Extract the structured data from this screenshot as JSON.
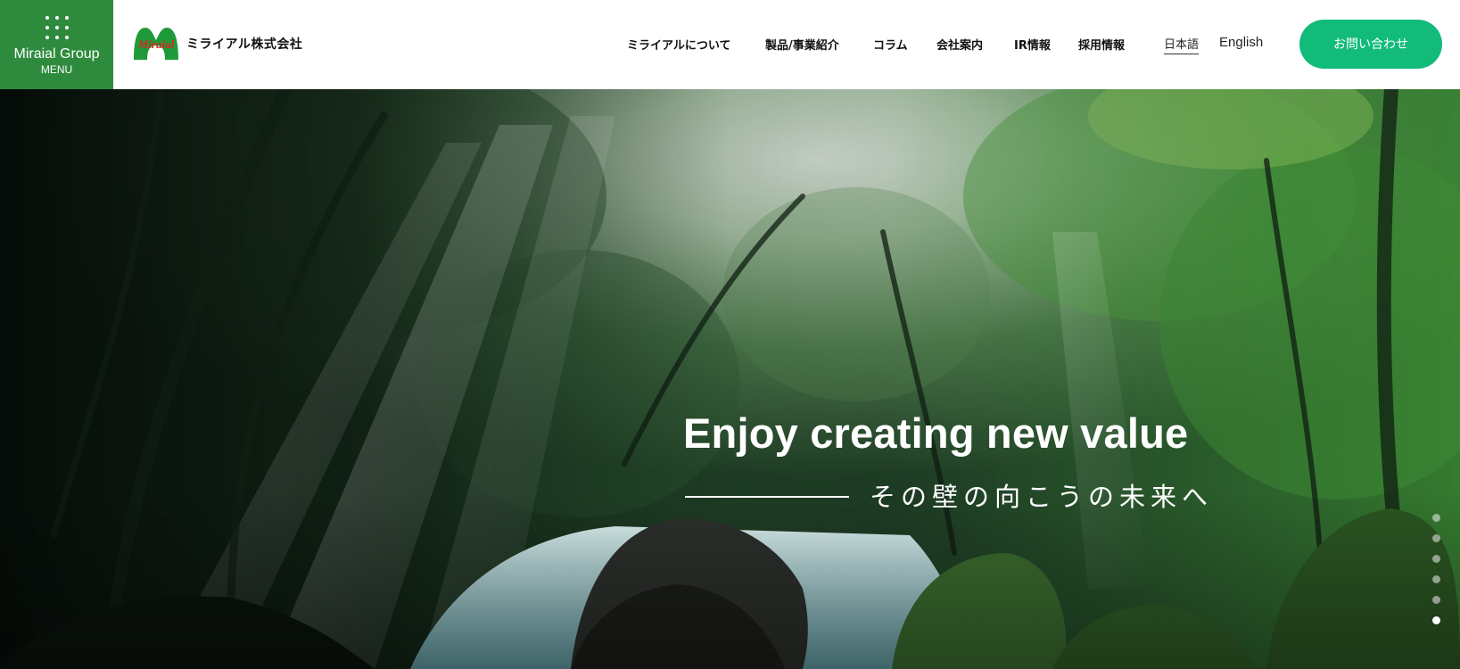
{
  "menu": {
    "group_label": "Miraial Group",
    "menu_label": "MENU"
  },
  "logo": {
    "mark_text": "Miraial",
    "company_name": "ミライアル株式会社"
  },
  "nav": {
    "items": [
      {
        "label": "ミライアルについて"
      },
      {
        "label": "製品/事業紹介"
      },
      {
        "label": "コラム"
      },
      {
        "label": "会社案内"
      },
      {
        "label": "IR情報"
      },
      {
        "label": "採用情報"
      }
    ],
    "lang_ja": "日本語",
    "lang_en": "English",
    "contact_label": "お問い合わせ"
  },
  "hero": {
    "headline": "Enjoy creating new value",
    "tagline": "その壁の向こうの未来へ",
    "slide_count": 6,
    "active_slide": 6
  },
  "colors": {
    "menu_bg": "#2e8b3e",
    "contact_bg": "#12bb7a",
    "logo_green": "#1f9a3a",
    "logo_red": "#d62a1e"
  }
}
